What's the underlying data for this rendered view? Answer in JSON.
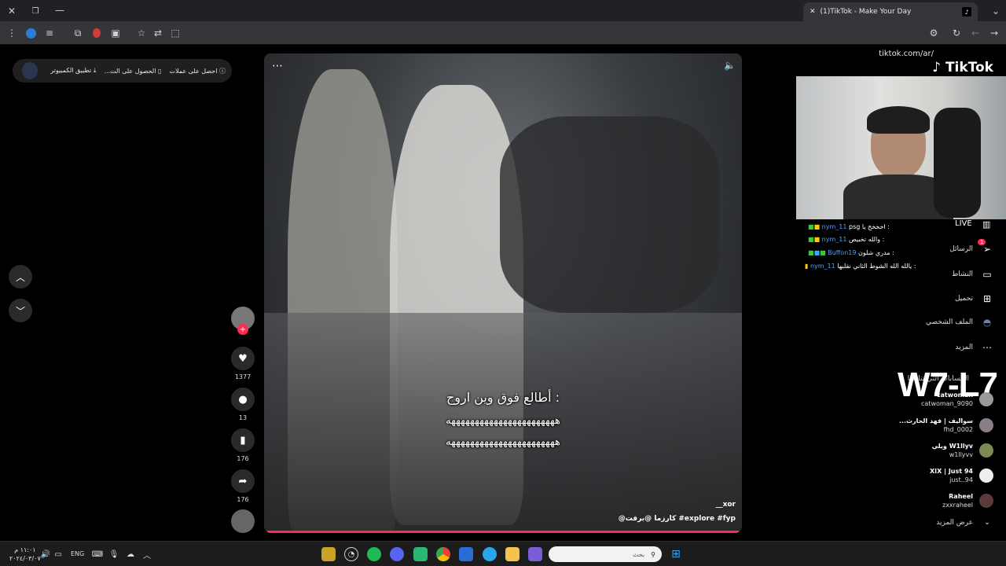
{
  "browser": {
    "tab_title": "(1)TikTok - Make Your Day",
    "url": "tiktok.com/ar/"
  },
  "left_panel": {
    "pill_items": [
      "احصل على عملات",
      "الحصول على الت...",
      "تطبيق الكمبيوتر"
    ]
  },
  "video": {
    "overlay_line1": "أطالع فوق وين اروح :",
    "overlay_line2": "هههههههههههههههههههههههه",
    "overlay_line3": "هههههههههههههههههههههههه",
    "author": "__xor",
    "caption": "@كارزما @برفت #explore #fyp"
  },
  "actions": {
    "likes": "1377",
    "comments": "13",
    "saves": "176",
    "shares": "176"
  },
  "brand": {
    "logo_text": "TikTok",
    "watermark": "W7-L7"
  },
  "live_label": "LIVE",
  "chat": [
    {
      "user": "nym_11",
      "text": "psg اخخخخ يا :"
    },
    {
      "user": "nym_11",
      "text": "والله تخبيص :"
    },
    {
      "user": "Buffon19",
      "text": "مدري شلون :"
    },
    {
      "user": "nym_11",
      "text": "يالله الله الشوط الثاني نقلبها :"
    }
  ],
  "nav": [
    {
      "label": "الرسائل",
      "icon": "send-icon",
      "badge": "1"
    },
    {
      "label": "النشاط",
      "icon": "message-icon"
    },
    {
      "label": "تحميل",
      "icon": "upload-icon"
    },
    {
      "label": "الملف الشخصي",
      "icon": "profile-icon"
    },
    {
      "label": "المزيد",
      "icon": "more-icon"
    }
  ],
  "following": {
    "title": "الحسابات التي تتابعها",
    "accounts": [
      {
        "name": "catwoman",
        "handle": "catwoman_9090"
      },
      {
        "name": "سواليف | فهد الحارث...",
        "handle": "fhd_0002"
      },
      {
        "name": "W1llyv ويلي",
        "handle": "w1llyvv"
      },
      {
        "name": "XIX | Just 94",
        "handle": "just..94"
      },
      {
        "name": "Raheel",
        "handle": "zxxraheel"
      }
    ],
    "see_more": "عرض المزيد"
  },
  "taskbar": {
    "search_placeholder": "بحث",
    "lang": "ENG",
    "time": "١١:٠١ م",
    "date": "٢٠٢٤/٠٣/٠٧"
  }
}
